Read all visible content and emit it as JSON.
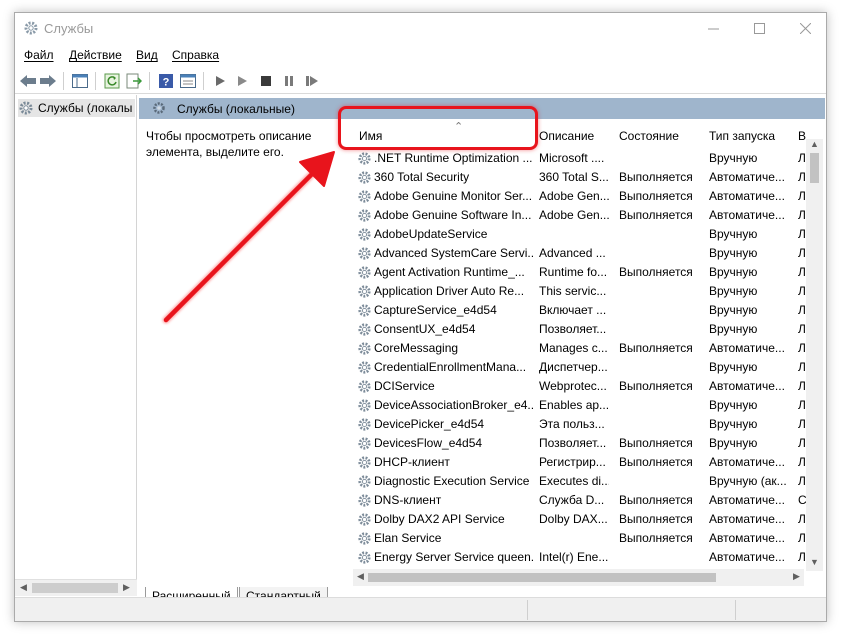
{
  "window": {
    "title": "Службы"
  },
  "menu": {
    "file": "Файл",
    "action": "Действие",
    "view": "Вид",
    "help": "Справка"
  },
  "tree": {
    "root_label": "Службы (локалы"
  },
  "pane": {
    "header_title": "Службы (локальные)",
    "description_line1": "Чтобы просмотреть описание",
    "description_line2": "элемента, выделите его."
  },
  "columns": {
    "name": "Имя",
    "description": "Описание",
    "state": "Состояние",
    "startup": "Тип запуска",
    "logon": "В"
  },
  "services": [
    {
      "name": ".NET Runtime Optimization ...",
      "description": "Microsoft ....",
      "state": "",
      "startup": "Вручную",
      "logon": "Л"
    },
    {
      "name": "360 Total Security",
      "description": "360 Total S...",
      "state": "Выполняется",
      "startup": "Автоматиче...",
      "logon": "Л"
    },
    {
      "name": "Adobe Genuine Monitor Ser...",
      "description": "Adobe Gen...",
      "state": "Выполняется",
      "startup": "Автоматиче...",
      "logon": "Л"
    },
    {
      "name": "Adobe Genuine Software In...",
      "description": "Adobe Gen...",
      "state": "Выполняется",
      "startup": "Автоматиче...",
      "logon": "Л"
    },
    {
      "name": "AdobeUpdateService",
      "description": "",
      "state": "",
      "startup": "Вручную",
      "logon": "Л"
    },
    {
      "name": "Advanced SystemCare Servi...",
      "description": "Advanced ...",
      "state": "",
      "startup": "Вручную",
      "logon": "Л"
    },
    {
      "name": "Agent Activation Runtime_...",
      "description": "Runtime fo...",
      "state": "Выполняется",
      "startup": "Вручную",
      "logon": "Л"
    },
    {
      "name": "Application Driver Auto Re...",
      "description": "This servic...",
      "state": "",
      "startup": "Вручную",
      "logon": "Л"
    },
    {
      "name": "CaptureService_e4d54",
      "description": "Включает ...",
      "state": "",
      "startup": "Вручную",
      "logon": "Л"
    },
    {
      "name": "ConsentUX_e4d54",
      "description": "Позволяет...",
      "state": "",
      "startup": "Вручную",
      "logon": "Л"
    },
    {
      "name": "CoreMessaging",
      "description": "Manages c...",
      "state": "Выполняется",
      "startup": "Автоматиче...",
      "logon": "Л"
    },
    {
      "name": "CredentialEnrollmentMana...",
      "description": "Диспетчер...",
      "state": "",
      "startup": "Вручную",
      "logon": "Л"
    },
    {
      "name": "DCIService",
      "description": "Webprotec...",
      "state": "Выполняется",
      "startup": "Автоматиче...",
      "logon": "Л"
    },
    {
      "name": "DeviceAssociationBroker_e4...",
      "description": "Enables ap...",
      "state": "",
      "startup": "Вручную",
      "logon": "Л"
    },
    {
      "name": "DevicePicker_e4d54",
      "description": "Эта польз...",
      "state": "",
      "startup": "Вручную",
      "logon": "Л"
    },
    {
      "name": "DevicesFlow_e4d54",
      "description": "Позволяет...",
      "state": "Выполняется",
      "startup": "Вручную",
      "logon": "Л"
    },
    {
      "name": "DHCP-клиент",
      "description": "Регистрир...",
      "state": "Выполняется",
      "startup": "Автоматиче...",
      "logon": "Л"
    },
    {
      "name": "Diagnostic Execution Service",
      "description": "Executes di...",
      "state": "",
      "startup": "Вручную (ак...",
      "logon": "Л"
    },
    {
      "name": "DNS-клиент",
      "description": "Служба D...",
      "state": "Выполняется",
      "startup": "Автоматиче...",
      "logon": "С"
    },
    {
      "name": "Dolby DAX2 API Service",
      "description": "Dolby DAX...",
      "state": "Выполняется",
      "startup": "Автоматиче...",
      "logon": "Л"
    },
    {
      "name": "Elan Service",
      "description": "",
      "state": "Выполняется",
      "startup": "Автоматиче...",
      "logon": "Л"
    },
    {
      "name": "Energy Server Service queen...",
      "description": "Intel(r) Ene...",
      "state": "",
      "startup": "Автоматиче...",
      "logon": "Л"
    }
  ],
  "tabs": {
    "extended": "Расширенный",
    "standard": "Стандартный"
  },
  "colors": {
    "highlight": "#e8141c",
    "pane_header": "#9fb5cc"
  }
}
